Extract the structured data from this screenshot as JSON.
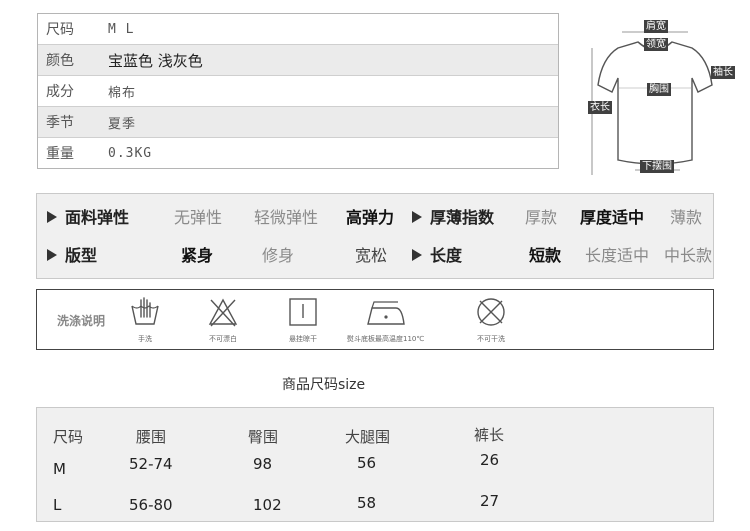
{
  "attributes": [
    {
      "label": "尺码",
      "value": "M L"
    },
    {
      "label": "颜色",
      "value": "宝蓝色 浅灰色"
    },
    {
      "label": "成分",
      "value": "棉布"
    },
    {
      "label": "季节",
      "value": "夏季"
    },
    {
      "label": "重量",
      "value": "0.3KG"
    }
  ],
  "diagram_labels": {
    "shoulder": "肩宽",
    "neck": "领宽",
    "sleeve": "袖长",
    "chest": "胸围",
    "length": "衣长",
    "hem": "下摆围"
  },
  "elasticity": {
    "fabric_label": "面料弹性",
    "fabric_options": [
      "无弹性",
      "轻微弹性",
      "高弹力"
    ],
    "thickness_label": "厚薄指数",
    "thickness_options": [
      "厚款",
      "厚度适中",
      "薄款"
    ],
    "fit_label": "版型",
    "fit_options": [
      "紧身",
      "修身",
      "宽松"
    ],
    "length_label": "长度",
    "length_options": [
      "短款",
      "长度适中",
      "中长款"
    ]
  },
  "washing": {
    "title": "洗涤说明",
    "items": [
      {
        "icon": "hand-wash-icon",
        "caption": "手洗"
      },
      {
        "icon": "no-bleach-icon",
        "caption": "不可漂白"
      },
      {
        "icon": "hang-dry-icon",
        "caption": "悬挂晾干"
      },
      {
        "icon": "iron-icon",
        "caption": "熨斗底板最高温度110℃"
      },
      {
        "icon": "no-dry-clean-icon",
        "caption": "不可干洗"
      }
    ]
  },
  "size_chart": {
    "title": "商品尺码size",
    "headers": [
      "尺码",
      "腰围",
      "臀围",
      "大腿围",
      "裤长"
    ],
    "rows": [
      [
        "M",
        "52-74",
        "98",
        "56",
        "26"
      ],
      [
        "L",
        "56-80",
        "102",
        "58",
        "27"
      ]
    ]
  }
}
